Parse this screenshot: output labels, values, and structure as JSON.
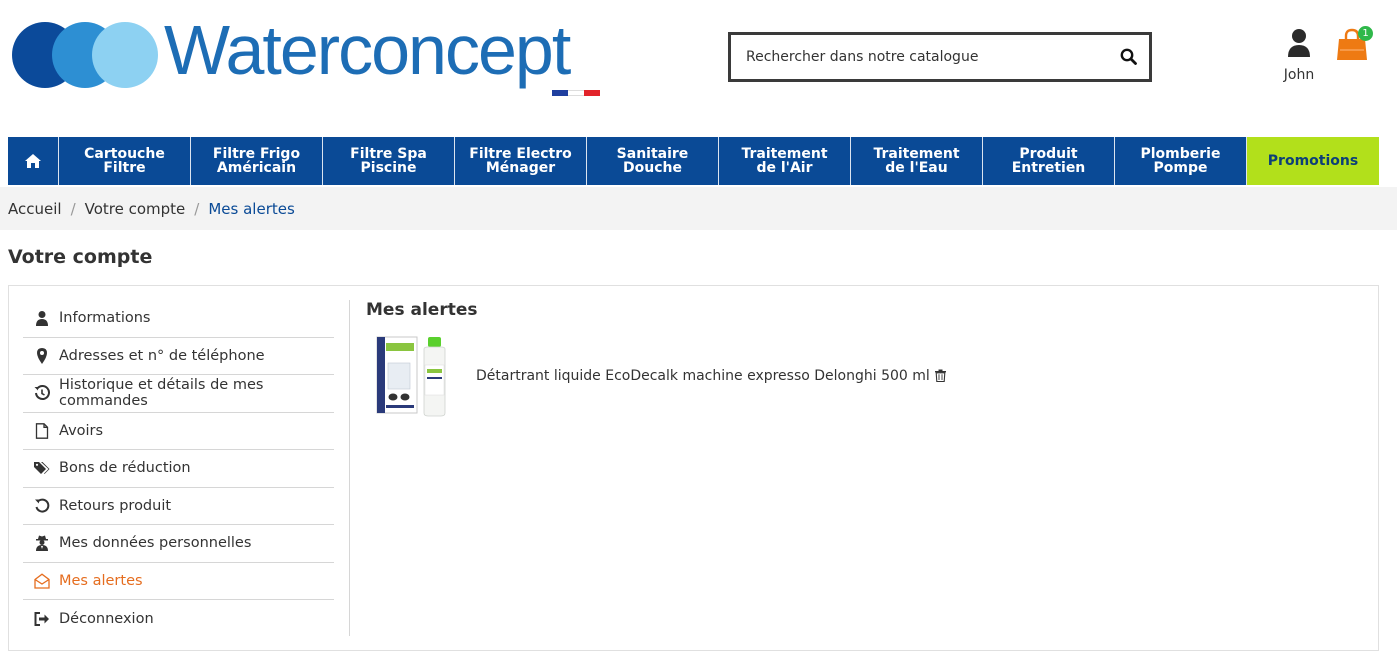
{
  "brand": {
    "name": "Waterconcept",
    "colors": {
      "circle1": "#0b4a9a",
      "circle2": "#2d8fd3",
      "circle3": "#8dd1f2",
      "text": "#1d6db5",
      "flag_blue": "#1f3f9f",
      "flag_white": "#ffffff",
      "flag_red": "#e2232a"
    }
  },
  "search": {
    "placeholder": "Rechercher dans notre catalogue",
    "icon": "search-icon"
  },
  "user": {
    "name": "John",
    "icon": "user-icon"
  },
  "cart": {
    "count": "1",
    "icon": "shopping-bag-icon",
    "color": "#ee7a13",
    "badge_color": "#2fb84a"
  },
  "nav": {
    "home_icon": "home-icon",
    "items": [
      {
        "line1": "Cartouche",
        "line2": "Filtre"
      },
      {
        "line1": "Filtre Frigo",
        "line2": "Américain"
      },
      {
        "line1": "Filtre Spa",
        "line2": "Piscine"
      },
      {
        "line1": "Filtre Electro",
        "line2": "Ménager"
      },
      {
        "line1": "Sanitaire",
        "line2": "Douche"
      },
      {
        "line1": "Traitement",
        "line2": "de l'Air"
      },
      {
        "line1": "Traitement",
        "line2": "de l'Eau"
      },
      {
        "line1": "Produit",
        "line2": "Entretien"
      },
      {
        "line1": "Plomberie",
        "line2": "Pompe"
      }
    ],
    "promo": "Promotions",
    "colors": {
      "bg": "#0a4a96",
      "promo_bg": "#b2e01b",
      "promo_text": "#0c3f78"
    }
  },
  "breadcrumb": {
    "items": [
      "Accueil",
      "Votre compte"
    ],
    "current": "Mes alertes"
  },
  "page": {
    "title": "Votre compte"
  },
  "sidebar": {
    "items": [
      {
        "label": "Informations",
        "icon": "user-icon"
      },
      {
        "label": "Adresses et n° de téléphone",
        "icon": "map-marker-icon"
      },
      {
        "label": "Historique et détails de mes commandes",
        "icon": "history-icon"
      },
      {
        "label": "Avoirs",
        "icon": "file-icon"
      },
      {
        "label": "Bons de réduction",
        "icon": "tags-icon"
      },
      {
        "label": "Retours produit",
        "icon": "undo-icon"
      },
      {
        "label": "Mes données personnelles",
        "icon": "user-secret-icon"
      },
      {
        "label": "Mes alertes",
        "icon": "envelope-open-icon",
        "active": true
      },
      {
        "label": "Déconnexion",
        "icon": "sign-out-icon"
      }
    ],
    "active_color": "#e56d1f"
  },
  "content": {
    "title": "Mes alertes",
    "alerts": [
      {
        "product": "Détartrant liquide EcoDecalk machine expresso Delonghi 500 ml",
        "image": "product-image",
        "remove_icon": "trash-icon"
      }
    ]
  }
}
